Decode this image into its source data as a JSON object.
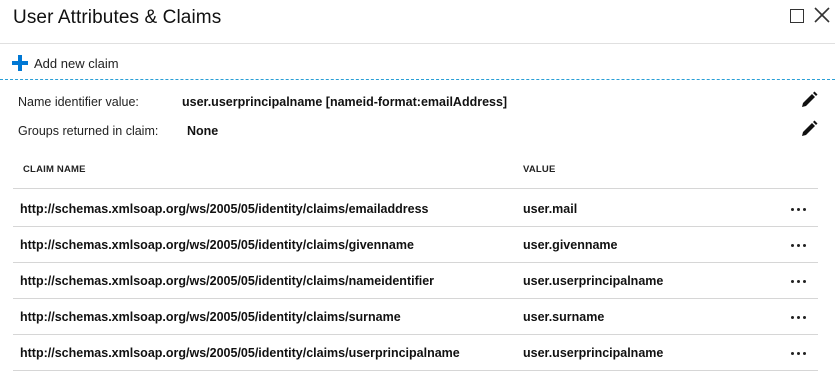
{
  "header": {
    "title": "User Attributes & Claims"
  },
  "toolbar": {
    "add_claim_label": "Add new claim"
  },
  "properties": {
    "name_identifier": {
      "label": "Name identifier value:",
      "value": "user.userprincipalname [nameid-format:emailAddress]"
    },
    "groups_returned": {
      "label": "Groups returned in claim:",
      "value": "None"
    }
  },
  "claims_table": {
    "columns": [
      "CLAIM NAME",
      "VALUE"
    ],
    "rows": [
      {
        "name": "http://schemas.xmlsoap.org/ws/2005/05/identity/claims/emailaddress",
        "value": "user.mail"
      },
      {
        "name": "http://schemas.xmlsoap.org/ws/2005/05/identity/claims/givenname",
        "value": "user.givenname"
      },
      {
        "name": "http://schemas.xmlsoap.org/ws/2005/05/identity/claims/nameidentifier",
        "value": "user.userprincipalname"
      },
      {
        "name": "http://schemas.xmlsoap.org/ws/2005/05/identity/claims/surname",
        "value": "user.surname"
      },
      {
        "name": "http://schemas.xmlsoap.org/ws/2005/05/identity/claims/userprincipalname",
        "value": "user.userprincipalname"
      }
    ]
  },
  "icons": {
    "add": "plus-icon",
    "edit": "pencil-icon",
    "row_menu": "more-options-icon",
    "window_maximize": "maximize-icon",
    "window_close": "close-icon"
  },
  "colors": {
    "accent": "#0078d4",
    "toolbar_divider": "#2a9fd6"
  }
}
